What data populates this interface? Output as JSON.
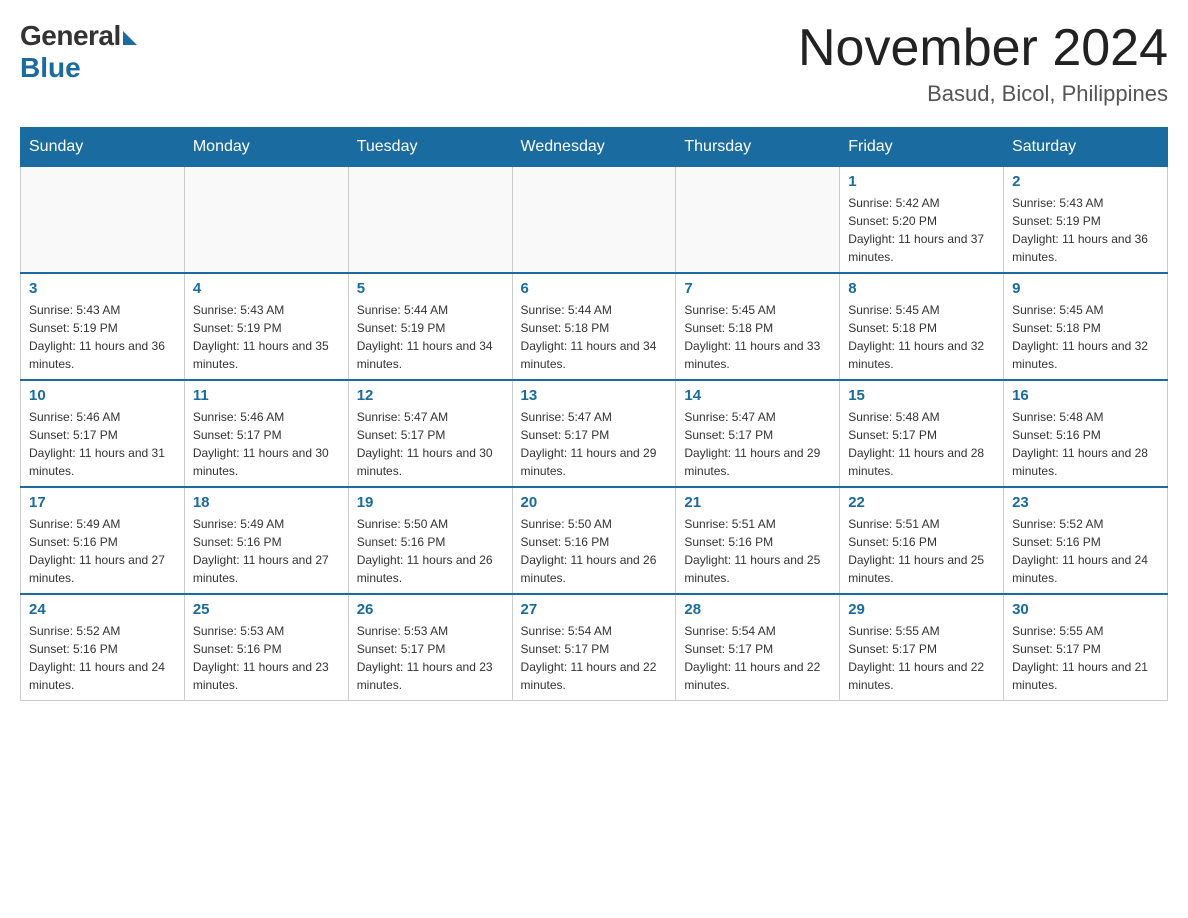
{
  "logo": {
    "general": "General",
    "blue": "Blue"
  },
  "title": {
    "month_year": "November 2024",
    "location": "Basud, Bicol, Philippines"
  },
  "days_of_week": [
    "Sunday",
    "Monday",
    "Tuesday",
    "Wednesday",
    "Thursday",
    "Friday",
    "Saturday"
  ],
  "weeks": [
    {
      "days": [
        {
          "number": "",
          "sunrise": "",
          "sunset": "",
          "daylight": "",
          "empty": true
        },
        {
          "number": "",
          "sunrise": "",
          "sunset": "",
          "daylight": "",
          "empty": true
        },
        {
          "number": "",
          "sunrise": "",
          "sunset": "",
          "daylight": "",
          "empty": true
        },
        {
          "number": "",
          "sunrise": "",
          "sunset": "",
          "daylight": "",
          "empty": true
        },
        {
          "number": "",
          "sunrise": "",
          "sunset": "",
          "daylight": "",
          "empty": true
        },
        {
          "number": "1",
          "sunrise": "Sunrise: 5:42 AM",
          "sunset": "Sunset: 5:20 PM",
          "daylight": "Daylight: 11 hours and 37 minutes.",
          "empty": false
        },
        {
          "number": "2",
          "sunrise": "Sunrise: 5:43 AM",
          "sunset": "Sunset: 5:19 PM",
          "daylight": "Daylight: 11 hours and 36 minutes.",
          "empty": false
        }
      ]
    },
    {
      "days": [
        {
          "number": "3",
          "sunrise": "Sunrise: 5:43 AM",
          "sunset": "Sunset: 5:19 PM",
          "daylight": "Daylight: 11 hours and 36 minutes.",
          "empty": false
        },
        {
          "number": "4",
          "sunrise": "Sunrise: 5:43 AM",
          "sunset": "Sunset: 5:19 PM",
          "daylight": "Daylight: 11 hours and 35 minutes.",
          "empty": false
        },
        {
          "number": "5",
          "sunrise": "Sunrise: 5:44 AM",
          "sunset": "Sunset: 5:19 PM",
          "daylight": "Daylight: 11 hours and 34 minutes.",
          "empty": false
        },
        {
          "number": "6",
          "sunrise": "Sunrise: 5:44 AM",
          "sunset": "Sunset: 5:18 PM",
          "daylight": "Daylight: 11 hours and 34 minutes.",
          "empty": false
        },
        {
          "number": "7",
          "sunrise": "Sunrise: 5:45 AM",
          "sunset": "Sunset: 5:18 PM",
          "daylight": "Daylight: 11 hours and 33 minutes.",
          "empty": false
        },
        {
          "number": "8",
          "sunrise": "Sunrise: 5:45 AM",
          "sunset": "Sunset: 5:18 PM",
          "daylight": "Daylight: 11 hours and 32 minutes.",
          "empty": false
        },
        {
          "number": "9",
          "sunrise": "Sunrise: 5:45 AM",
          "sunset": "Sunset: 5:18 PM",
          "daylight": "Daylight: 11 hours and 32 minutes.",
          "empty": false
        }
      ]
    },
    {
      "days": [
        {
          "number": "10",
          "sunrise": "Sunrise: 5:46 AM",
          "sunset": "Sunset: 5:17 PM",
          "daylight": "Daylight: 11 hours and 31 minutes.",
          "empty": false
        },
        {
          "number": "11",
          "sunrise": "Sunrise: 5:46 AM",
          "sunset": "Sunset: 5:17 PM",
          "daylight": "Daylight: 11 hours and 30 minutes.",
          "empty": false
        },
        {
          "number": "12",
          "sunrise": "Sunrise: 5:47 AM",
          "sunset": "Sunset: 5:17 PM",
          "daylight": "Daylight: 11 hours and 30 minutes.",
          "empty": false
        },
        {
          "number": "13",
          "sunrise": "Sunrise: 5:47 AM",
          "sunset": "Sunset: 5:17 PM",
          "daylight": "Daylight: 11 hours and 29 minutes.",
          "empty": false
        },
        {
          "number": "14",
          "sunrise": "Sunrise: 5:47 AM",
          "sunset": "Sunset: 5:17 PM",
          "daylight": "Daylight: 11 hours and 29 minutes.",
          "empty": false
        },
        {
          "number": "15",
          "sunrise": "Sunrise: 5:48 AM",
          "sunset": "Sunset: 5:17 PM",
          "daylight": "Daylight: 11 hours and 28 minutes.",
          "empty": false
        },
        {
          "number": "16",
          "sunrise": "Sunrise: 5:48 AM",
          "sunset": "Sunset: 5:16 PM",
          "daylight": "Daylight: 11 hours and 28 minutes.",
          "empty": false
        }
      ]
    },
    {
      "days": [
        {
          "number": "17",
          "sunrise": "Sunrise: 5:49 AM",
          "sunset": "Sunset: 5:16 PM",
          "daylight": "Daylight: 11 hours and 27 minutes.",
          "empty": false
        },
        {
          "number": "18",
          "sunrise": "Sunrise: 5:49 AM",
          "sunset": "Sunset: 5:16 PM",
          "daylight": "Daylight: 11 hours and 27 minutes.",
          "empty": false
        },
        {
          "number": "19",
          "sunrise": "Sunrise: 5:50 AM",
          "sunset": "Sunset: 5:16 PM",
          "daylight": "Daylight: 11 hours and 26 minutes.",
          "empty": false
        },
        {
          "number": "20",
          "sunrise": "Sunrise: 5:50 AM",
          "sunset": "Sunset: 5:16 PM",
          "daylight": "Daylight: 11 hours and 26 minutes.",
          "empty": false
        },
        {
          "number": "21",
          "sunrise": "Sunrise: 5:51 AM",
          "sunset": "Sunset: 5:16 PM",
          "daylight": "Daylight: 11 hours and 25 minutes.",
          "empty": false
        },
        {
          "number": "22",
          "sunrise": "Sunrise: 5:51 AM",
          "sunset": "Sunset: 5:16 PM",
          "daylight": "Daylight: 11 hours and 25 minutes.",
          "empty": false
        },
        {
          "number": "23",
          "sunrise": "Sunrise: 5:52 AM",
          "sunset": "Sunset: 5:16 PM",
          "daylight": "Daylight: 11 hours and 24 minutes.",
          "empty": false
        }
      ]
    },
    {
      "days": [
        {
          "number": "24",
          "sunrise": "Sunrise: 5:52 AM",
          "sunset": "Sunset: 5:16 PM",
          "daylight": "Daylight: 11 hours and 24 minutes.",
          "empty": false
        },
        {
          "number": "25",
          "sunrise": "Sunrise: 5:53 AM",
          "sunset": "Sunset: 5:16 PM",
          "daylight": "Daylight: 11 hours and 23 minutes.",
          "empty": false
        },
        {
          "number": "26",
          "sunrise": "Sunrise: 5:53 AM",
          "sunset": "Sunset: 5:17 PM",
          "daylight": "Daylight: 11 hours and 23 minutes.",
          "empty": false
        },
        {
          "number": "27",
          "sunrise": "Sunrise: 5:54 AM",
          "sunset": "Sunset: 5:17 PM",
          "daylight": "Daylight: 11 hours and 22 minutes.",
          "empty": false
        },
        {
          "number": "28",
          "sunrise": "Sunrise: 5:54 AM",
          "sunset": "Sunset: 5:17 PM",
          "daylight": "Daylight: 11 hours and 22 minutes.",
          "empty": false
        },
        {
          "number": "29",
          "sunrise": "Sunrise: 5:55 AM",
          "sunset": "Sunset: 5:17 PM",
          "daylight": "Daylight: 11 hours and 22 minutes.",
          "empty": false
        },
        {
          "number": "30",
          "sunrise": "Sunrise: 5:55 AM",
          "sunset": "Sunset: 5:17 PM",
          "daylight": "Daylight: 11 hours and 21 minutes.",
          "empty": false
        }
      ]
    }
  ]
}
